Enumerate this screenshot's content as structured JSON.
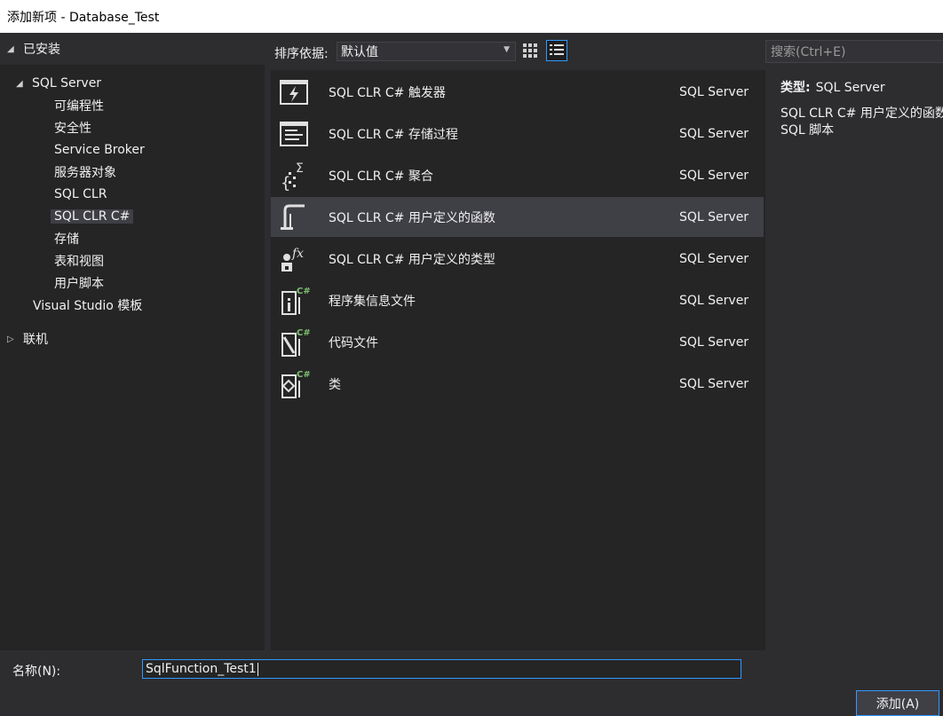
{
  "window": {
    "title": "添加新项 - Database_Test"
  },
  "tree": {
    "installed": "已安装",
    "sql_server": "SQL Server",
    "children": [
      "可编程性",
      "安全性",
      "Service Broker",
      "服务器对象",
      "SQL CLR",
      "SQL CLR C#",
      "存储",
      "表和视图",
      "用户脚本"
    ],
    "vs_templates": "Visual Studio 模板",
    "online": "联机"
  },
  "toolbar": {
    "sort_label": "排序依据:",
    "sort_value": "默认值"
  },
  "templates": [
    {
      "name": "SQL CLR C# 触发器",
      "category": "SQL Server",
      "icon": "trigger-icon"
    },
    {
      "name": "SQL CLR C# 存储过程",
      "category": "SQL Server",
      "icon": "stored-procedure-icon"
    },
    {
      "name": "SQL CLR C# 聚合",
      "category": "SQL Server",
      "icon": "aggregate-icon"
    },
    {
      "name": "SQL CLR C# 用户定义的函数",
      "category": "SQL Server",
      "icon": "user-function-icon"
    },
    {
      "name": "SQL CLR C# 用户定义的类型",
      "category": "SQL Server",
      "icon": "user-type-icon"
    },
    {
      "name": "程序集信息文件",
      "category": "SQL Server",
      "icon": "assembly-info-icon"
    },
    {
      "name": "代码文件",
      "category": "SQL Server",
      "icon": "code-file-icon"
    },
    {
      "name": "类",
      "category": "SQL Server",
      "icon": "class-icon"
    }
  ],
  "details": {
    "search_placeholder": "搜索(Ctrl+E)",
    "type_label": "类型:",
    "type_value": "SQL Server",
    "desc_line1": "SQL CLR C# 用户定义的函数",
    "desc_line2": "SQL 脚本"
  },
  "footer": {
    "name_label": "名称(N):",
    "name_value": "SqlFunction_Test1",
    "add_button": "添加(A)"
  },
  "colors": {
    "accent": "#3399ff",
    "background": "#2d2d30",
    "panel": "#252526",
    "selected": "#3f3f46",
    "csharp_badge": "#7fc16f"
  }
}
